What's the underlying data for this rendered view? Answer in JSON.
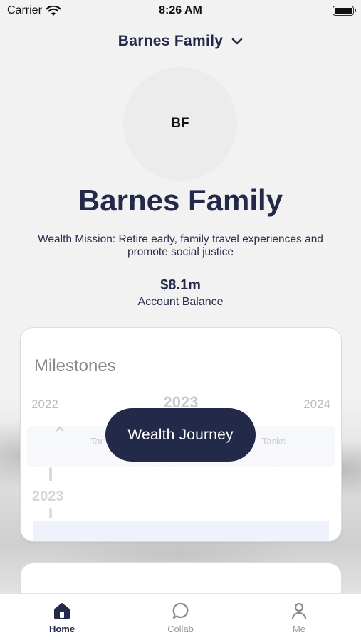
{
  "status": {
    "carrier": "Carrier",
    "time": "8:26 AM"
  },
  "header": {
    "family_name": "Barnes Family"
  },
  "profile": {
    "initials": "BF",
    "name": "Barnes Family",
    "mission": "Wealth Mission: Retire early, family travel experiences and promote social justice",
    "balance": "$8.1m",
    "balance_label": "Account Balance"
  },
  "milestones": {
    "title": "Milestones",
    "years": [
      "2022",
      "2023",
      "2024"
    ],
    "strip_left": "Tar",
    "strip_right": "Tasks",
    "timeline_year": "2023"
  },
  "cta": {
    "label": "Wealth Journey"
  },
  "tabs": [
    {
      "label": "Home",
      "icon": "home-icon",
      "active": true
    },
    {
      "label": "Collab",
      "icon": "chat-bubble-icon",
      "active": false
    },
    {
      "label": "Me",
      "icon": "person-icon",
      "active": false
    }
  ],
  "colors": {
    "navy": "#232949",
    "background": "#f2f2f2"
  }
}
